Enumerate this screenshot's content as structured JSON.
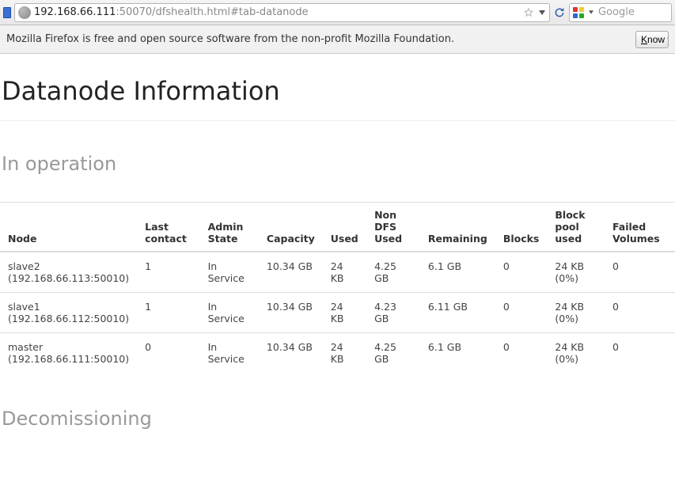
{
  "browser": {
    "url_dark": "192.168.66.111",
    "url_rest": ":50070/dfshealth.html#tab-datanode",
    "search_placeholder": "Google",
    "info_text": "Mozilla Firefox is free and open source software from the non-profit Mozilla Foundation.",
    "know_label": "Know y"
  },
  "page": {
    "title": "Datanode Information",
    "section_in_operation": "In operation",
    "section_decom": "Decomissioning"
  },
  "table": {
    "headers": {
      "node": "Node",
      "last_contact": "Last contact",
      "admin_state": "Admin State",
      "capacity": "Capacity",
      "used": "Used",
      "non_dfs_used": "Non DFS Used",
      "remaining": "Remaining",
      "blocks": "Blocks",
      "block_pool_used": "Block pool used",
      "failed_volumes": "Failed Volumes"
    },
    "rows": [
      {
        "node_name": "slave2",
        "node_addr": "(192.168.66.113:50010)",
        "last_contact": "1",
        "admin_state": "In Service",
        "capacity": "10.34 GB",
        "used": "24 KB",
        "non_dfs_used": "4.25 GB",
        "remaining": "6.1 GB",
        "blocks": "0",
        "block_pool_used": "24 KB (0%)",
        "failed_volumes": "0"
      },
      {
        "node_name": "slave1",
        "node_addr": "(192.168.66.112:50010)",
        "last_contact": "1",
        "admin_state": "In Service",
        "capacity": "10.34 GB",
        "used": "24 KB",
        "non_dfs_used": "4.23 GB",
        "remaining": "6.11 GB",
        "blocks": "0",
        "block_pool_used": "24 KB (0%)",
        "failed_volumes": "0"
      },
      {
        "node_name": "master",
        "node_addr": "(192.168.66.111:50010)",
        "last_contact": "0",
        "admin_state": "In Service",
        "capacity": "10.34 GB",
        "used": "24 KB",
        "non_dfs_used": "4.25 GB",
        "remaining": "6.1 GB",
        "blocks": "0",
        "block_pool_used": "24 KB (0%)",
        "failed_volumes": "0"
      }
    ]
  }
}
